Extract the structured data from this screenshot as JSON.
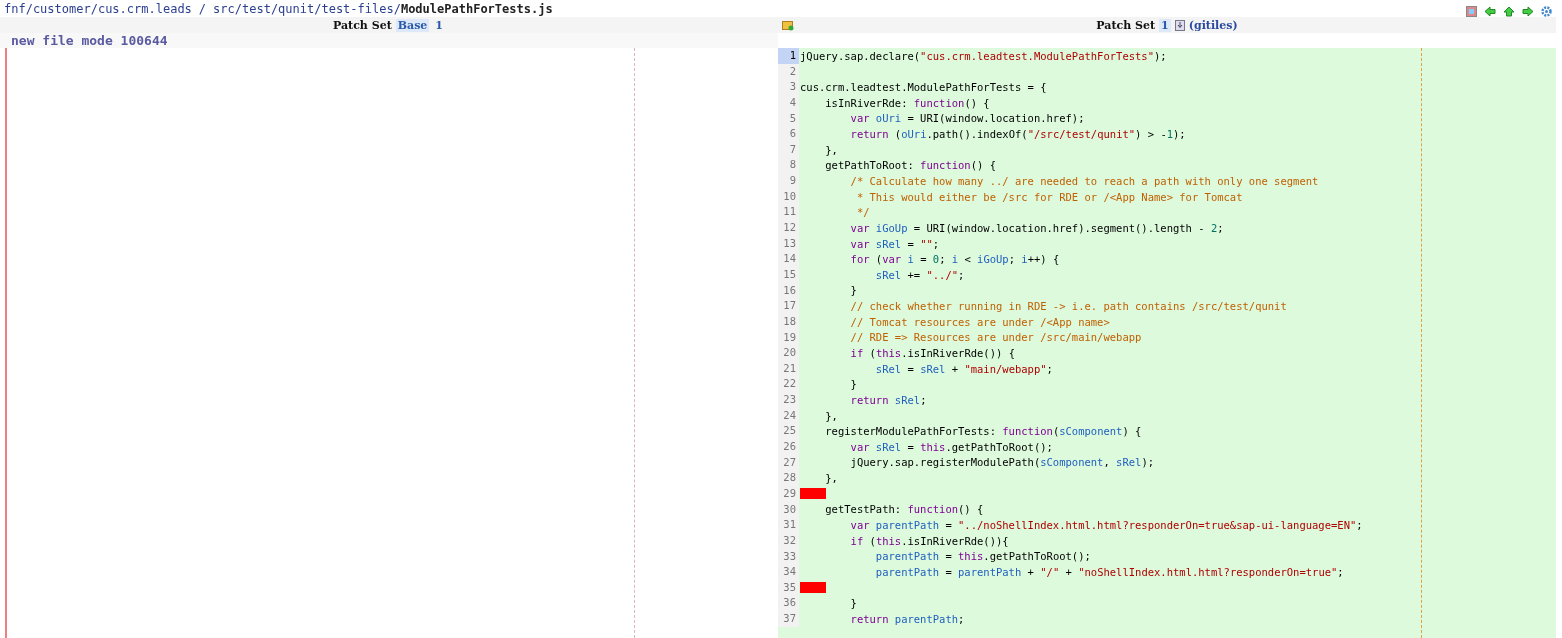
{
  "breadcrumb": {
    "project": "fnf/customer/cus.crm.leads",
    "separator": "/",
    "directory": "src/test/qunit/test-files/",
    "file": "ModulePathForTests.js"
  },
  "left": {
    "header": {
      "label": "Patch Set",
      "options": [
        {
          "label": "Base",
          "selected": true
        },
        {
          "label": "1",
          "selected": false
        }
      ]
    },
    "file_mode": "new file mode 100644"
  },
  "right": {
    "header": {
      "label": "Patch Set",
      "options": [
        {
          "label": "1",
          "selected": true
        }
      ],
      "link": "(gitiles)"
    },
    "lines": [
      {
        "number": "1",
        "selected": true,
        "whitespace_error": false,
        "tokens": [
          {
            "kind": "p",
            "text": "jQuery.sap.declare("
          },
          {
            "kind": "s",
            "text": "\"cus.crm.leadtest.ModulePathForTests\""
          },
          {
            "kind": "p",
            "text": ");"
          }
        ]
      },
      {
        "number": "2",
        "selected": false,
        "whitespace_error": false
      },
      {
        "number": "3",
        "selected": false,
        "whitespace_error": false,
        "tokens": [
          {
            "kind": "p",
            "text": "cus.crm.leadtest.ModulePathForTests = {"
          }
        ]
      },
      {
        "number": "4",
        "selected": false,
        "whitespace_error": false,
        "tokens": [
          {
            "kind": "p",
            "text": "    isInRiverRde: "
          },
          {
            "kind": "k",
            "text": "function"
          },
          {
            "kind": "p",
            "text": "() {"
          }
        ]
      },
      {
        "number": "5",
        "selected": false,
        "whitespace_error": false,
        "tokens": [
          {
            "kind": "k",
            "text": "        var "
          },
          {
            "kind": "v",
            "text": "oUri"
          },
          {
            "kind": "p",
            "text": " = URI(window.location.href);"
          }
        ]
      },
      {
        "number": "6",
        "selected": false,
        "whitespace_error": false,
        "tokens": [
          {
            "kind": "k",
            "text": "        return"
          },
          {
            "kind": "p",
            "text": " ("
          },
          {
            "kind": "v",
            "text": "oUri"
          },
          {
            "kind": "p",
            "text": ".path().indexOf("
          },
          {
            "kind": "s",
            "text": "\"/src/test/qunit\""
          },
          {
            "kind": "p",
            "text": ") > -"
          },
          {
            "kind": "n",
            "text": "1"
          },
          {
            "kind": "p",
            "text": ");"
          }
        ]
      },
      {
        "number": "7",
        "selected": false,
        "whitespace_error": false,
        "tokens": [
          {
            "kind": "p",
            "text": "    },"
          }
        ]
      },
      {
        "number": "8",
        "selected": false,
        "whitespace_error": false,
        "tokens": [
          {
            "kind": "p",
            "text": "    getPathToRoot: "
          },
          {
            "kind": "k",
            "text": "function"
          },
          {
            "kind": "p",
            "text": "() {"
          }
        ]
      },
      {
        "number": "9",
        "selected": false,
        "whitespace_error": false,
        "tokens": [
          {
            "kind": "c",
            "text": "        /* Calculate how many ../ are needed to reach a path with only one segment"
          }
        ]
      },
      {
        "number": "10",
        "selected": false,
        "whitespace_error": false,
        "tokens": [
          {
            "kind": "c",
            "text": "         * This would either be /src for RDE or /<App Name> for Tomcat"
          }
        ]
      },
      {
        "number": "11",
        "selected": false,
        "whitespace_error": false,
        "tokens": [
          {
            "kind": "c",
            "text": "         */"
          }
        ]
      },
      {
        "number": "12",
        "selected": false,
        "whitespace_error": false,
        "tokens": [
          {
            "kind": "k",
            "text": "        var "
          },
          {
            "kind": "v",
            "text": "iGoUp"
          },
          {
            "kind": "p",
            "text": " = URI(window.location.href).segment().length - "
          },
          {
            "kind": "n",
            "text": "2"
          },
          {
            "kind": "p",
            "text": ";"
          }
        ]
      },
      {
        "number": "13",
        "selected": false,
        "whitespace_error": false,
        "tokens": [
          {
            "kind": "k",
            "text": "        var "
          },
          {
            "kind": "v",
            "text": "sRel"
          },
          {
            "kind": "p",
            "text": " = "
          },
          {
            "kind": "s",
            "text": "\"\""
          },
          {
            "kind": "p",
            "text": ";"
          }
        ]
      },
      {
        "number": "14",
        "selected": false,
        "whitespace_error": false,
        "tokens": [
          {
            "kind": "k",
            "text": "        for"
          },
          {
            "kind": "p",
            "text": " ("
          },
          {
            "kind": "k",
            "text": "var "
          },
          {
            "kind": "v",
            "text": "i"
          },
          {
            "kind": "p",
            "text": " = "
          },
          {
            "kind": "n",
            "text": "0"
          },
          {
            "kind": "p",
            "text": "; "
          },
          {
            "kind": "v",
            "text": "i"
          },
          {
            "kind": "p",
            "text": " < "
          },
          {
            "kind": "v",
            "text": "iGoUp"
          },
          {
            "kind": "p",
            "text": "; "
          },
          {
            "kind": "v",
            "text": "i"
          },
          {
            "kind": "p",
            "text": "++) {"
          }
        ]
      },
      {
        "number": "15",
        "selected": false,
        "whitespace_error": false,
        "tokens": [
          {
            "kind": "v",
            "text": "            sRel"
          },
          {
            "kind": "p",
            "text": " += "
          },
          {
            "kind": "s",
            "text": "\"../\""
          },
          {
            "kind": "p",
            "text": ";"
          }
        ]
      },
      {
        "number": "16",
        "selected": false,
        "whitespace_error": false,
        "tokens": [
          {
            "kind": "p",
            "text": "        }"
          }
        ]
      },
      {
        "number": "17",
        "selected": false,
        "whitespace_error": false,
        "tokens": [
          {
            "kind": "c",
            "text": "        // check whether running in RDE -> i.e. path contains /src/test/qunit"
          }
        ]
      },
      {
        "number": "18",
        "selected": false,
        "whitespace_error": false,
        "tokens": [
          {
            "kind": "c",
            "text": "        // Tomcat resources are under /<App name>"
          }
        ]
      },
      {
        "number": "19",
        "selected": false,
        "whitespace_error": false,
        "tokens": [
          {
            "kind": "c",
            "text": "        // RDE => Resources are under /src/main/webapp"
          }
        ]
      },
      {
        "number": "20",
        "selected": false,
        "whitespace_error": false,
        "tokens": [
          {
            "kind": "k",
            "text": "        if"
          },
          {
            "kind": "p",
            "text": " ("
          },
          {
            "kind": "k",
            "text": "this"
          },
          {
            "kind": "p",
            "text": ".isInRiverRde()) {"
          }
        ]
      },
      {
        "number": "21",
        "selected": false,
        "whitespace_error": false,
        "tokens": [
          {
            "kind": "v",
            "text": "            sRel"
          },
          {
            "kind": "p",
            "text": " = "
          },
          {
            "kind": "v",
            "text": "sRel"
          },
          {
            "kind": "p",
            "text": " + "
          },
          {
            "kind": "s",
            "text": "\"main/webapp\""
          },
          {
            "kind": "p",
            "text": ";"
          }
        ]
      },
      {
        "number": "22",
        "selected": false,
        "whitespace_error": false,
        "tokens": [
          {
            "kind": "p",
            "text": "        }"
          }
        ]
      },
      {
        "number": "23",
        "selected": false,
        "whitespace_error": false,
        "tokens": [
          {
            "kind": "k",
            "text": "        return "
          },
          {
            "kind": "v",
            "text": "sRel"
          },
          {
            "kind": "p",
            "text": ";"
          }
        ]
      },
      {
        "number": "24",
        "selected": false,
        "whitespace_error": false,
        "tokens": [
          {
            "kind": "p",
            "text": "    },"
          }
        ]
      },
      {
        "number": "25",
        "selected": false,
        "whitespace_error": false,
        "tokens": [
          {
            "kind": "p",
            "text": "    registerModulePathForTests: "
          },
          {
            "kind": "k",
            "text": "function"
          },
          {
            "kind": "p",
            "text": "("
          },
          {
            "kind": "v",
            "text": "sComponent"
          },
          {
            "kind": "p",
            "text": ") {"
          }
        ]
      },
      {
        "number": "26",
        "selected": false,
        "whitespace_error": false,
        "tokens": [
          {
            "kind": "k",
            "text": "        var "
          },
          {
            "kind": "v",
            "text": "sRel"
          },
          {
            "kind": "p",
            "text": " = "
          },
          {
            "kind": "k",
            "text": "this"
          },
          {
            "kind": "p",
            "text": ".getPathToRoot();"
          }
        ]
      },
      {
        "number": "27",
        "selected": false,
        "whitespace_error": false,
        "tokens": [
          {
            "kind": "p",
            "text": "        jQuery.sap.registerModulePath("
          },
          {
            "kind": "v",
            "text": "sComponent"
          },
          {
            "kind": "p",
            "text": ", "
          },
          {
            "kind": "v",
            "text": "sRel"
          },
          {
            "kind": "p",
            "text": ");"
          }
        ]
      },
      {
        "number": "28",
        "selected": false,
        "whitespace_error": false,
        "tokens": [
          {
            "kind": "p",
            "text": "    },"
          }
        ]
      },
      {
        "number": "29",
        "selected": false,
        "whitespace_error": true
      },
      {
        "number": "30",
        "selected": false,
        "whitespace_error": false,
        "tokens": [
          {
            "kind": "p",
            "text": "    getTestPath: "
          },
          {
            "kind": "k",
            "text": "function"
          },
          {
            "kind": "p",
            "text": "() {"
          }
        ]
      },
      {
        "number": "31",
        "selected": false,
        "whitespace_error": false,
        "tokens": [
          {
            "kind": "k",
            "text": "        var "
          },
          {
            "kind": "v",
            "text": "parentPath"
          },
          {
            "kind": "p",
            "text": " = "
          },
          {
            "kind": "s",
            "text": "\"../noShellIndex.html.html?responderOn=true&sap-ui-language=EN\""
          },
          {
            "kind": "p",
            "text": ";"
          }
        ]
      },
      {
        "number": "32",
        "selected": false,
        "whitespace_error": false,
        "tokens": [
          {
            "kind": "k",
            "text": "        if"
          },
          {
            "kind": "p",
            "text": " ("
          },
          {
            "kind": "k",
            "text": "this"
          },
          {
            "kind": "p",
            "text": ".isInRiverRde()){"
          }
        ]
      },
      {
        "number": "33",
        "selected": false,
        "whitespace_error": false,
        "tokens": [
          {
            "kind": "v",
            "text": "            parentPath"
          },
          {
            "kind": "p",
            "text": " = "
          },
          {
            "kind": "k",
            "text": "this"
          },
          {
            "kind": "p",
            "text": ".getPathToRoot();"
          }
        ]
      },
      {
        "number": "34",
        "selected": false,
        "whitespace_error": false,
        "tokens": [
          {
            "kind": "v",
            "text": "            parentPath"
          },
          {
            "kind": "p",
            "text": " = "
          },
          {
            "kind": "v",
            "text": "parentPath"
          },
          {
            "kind": "p",
            "text": " + "
          },
          {
            "kind": "s",
            "text": "\"/\""
          },
          {
            "kind": "p",
            "text": " + "
          },
          {
            "kind": "s",
            "text": "\"noShellIndex.html.html?responderOn=true\""
          },
          {
            "kind": "p",
            "text": ";"
          }
        ]
      },
      {
        "number": "35",
        "selected": false,
        "whitespace_error": true
      },
      {
        "number": "36",
        "selected": false,
        "whitespace_error": false,
        "tokens": [
          {
            "kind": "p",
            "text": "        }"
          }
        ]
      },
      {
        "number": "37",
        "selected": false,
        "whitespace_error": false,
        "tokens": [
          {
            "kind": "k",
            "text": "        return "
          },
          {
            "kind": "v",
            "text": "parentPath"
          },
          {
            "kind": "p",
            "text": ";"
          }
        ]
      }
    ]
  }
}
